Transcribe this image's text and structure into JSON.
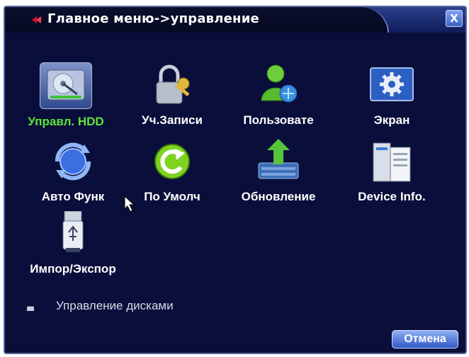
{
  "title": "Главное меню->управление",
  "close_label": "X",
  "tiles": [
    {
      "label": "Управл. HDD",
      "icon": "hdd-icon",
      "selected": true
    },
    {
      "label": "Уч.Записи",
      "icon": "lock-key-icon"
    },
    {
      "label": "Пользовате",
      "icon": "user-icon"
    },
    {
      "label": "Экран",
      "icon": "gear-screen-icon"
    },
    {
      "label": "Авто Функ",
      "icon": "auto-maintain-icon"
    },
    {
      "label": "По Умолч",
      "icon": "restore-default-icon"
    },
    {
      "label": "Обновление",
      "icon": "upgrade-icon"
    },
    {
      "label": "Device Info.",
      "icon": "device-info-icon"
    },
    {
      "label": "Импор/Экспор",
      "icon": "usb-icon"
    }
  ],
  "status_text": "Управление дисками",
  "cancel_label": "Отмена",
  "colors": {
    "background": "#0a0e3a",
    "title_bar": "#2a3f8c",
    "selected_label": "#5ee43a",
    "button": "#2f58c8"
  }
}
